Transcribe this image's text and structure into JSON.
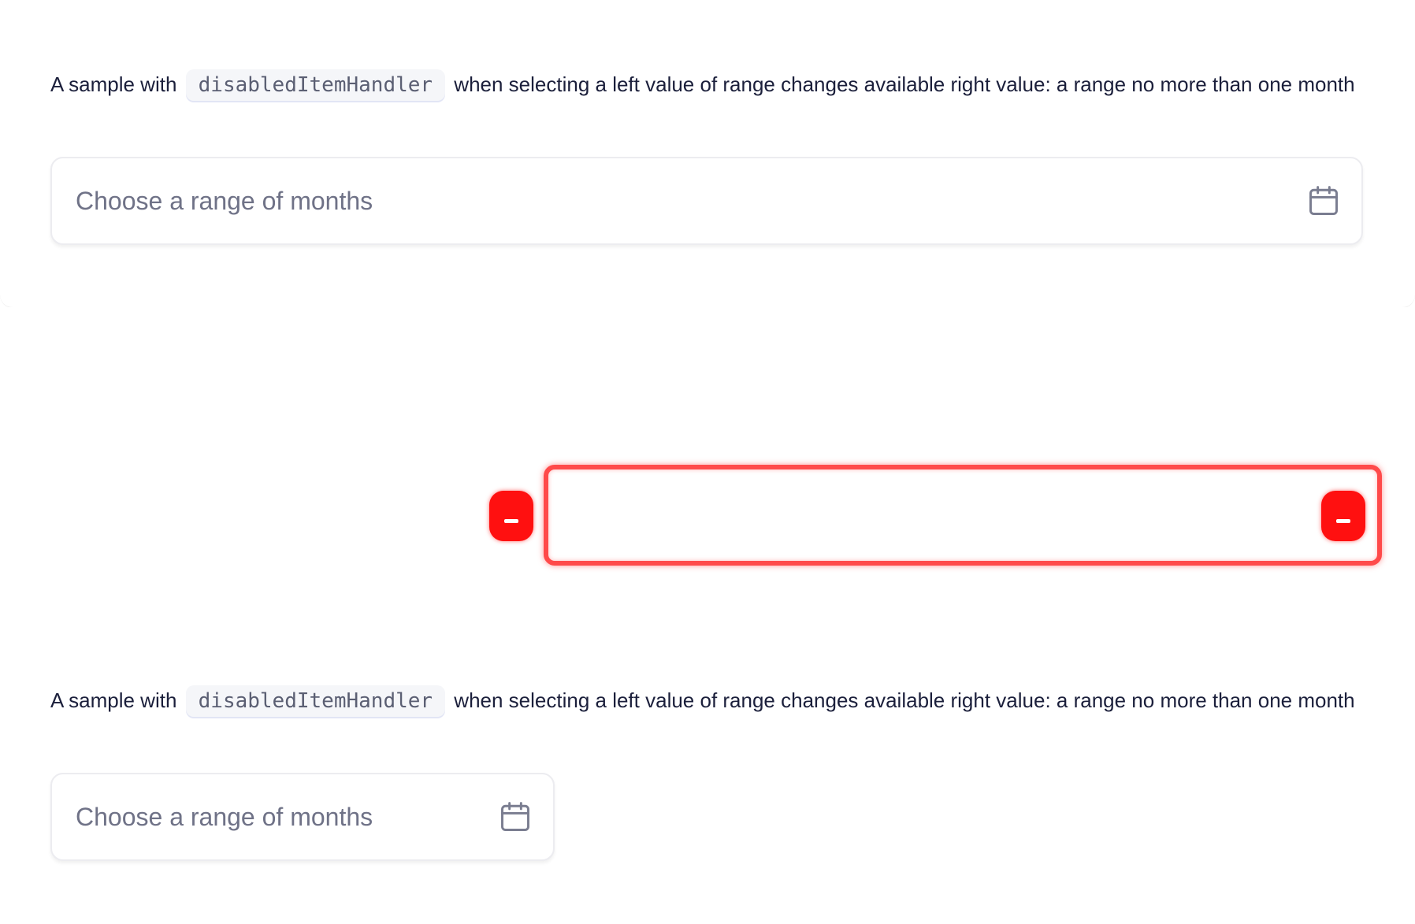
{
  "section_top": {
    "description_prefix": "A sample with",
    "code_token": "disabledItemHandler",
    "description_suffix": "when selecting a left value of range changes available right value: a range no more than one month",
    "input": {
      "placeholder": "Choose a range of months",
      "icon": "calendar-icon"
    }
  },
  "section_bottom": {
    "description_prefix": "A sample with",
    "code_token": "disabledItemHandler",
    "description_suffix": "when selecting a left value of range changes available right value: a range no more than one month",
    "input": {
      "placeholder": "Choose a range of months",
      "icon": "calendar-icon"
    }
  },
  "overlay": {
    "accent_color": "#ff1010",
    "left_handle_icon": "minus-icon",
    "right_handle_icon": "minus-icon"
  }
}
